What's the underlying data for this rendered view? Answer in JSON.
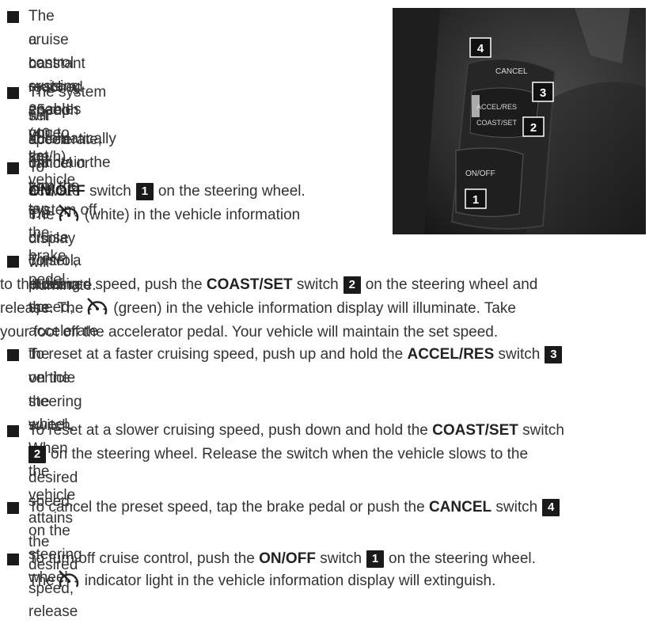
{
  "photo": {
    "cancel_label": "CANCEL",
    "accel_res_label": "ACCEL/RES",
    "coast_set_label": "COAST/SET",
    "on_off_label": "ON/OFF",
    "callouts": [
      "4",
      "3",
      "2",
      "1"
    ]
  },
  "items": [
    {
      "line1": "The cruise control system enables you to set",
      "line2": "a constant cruising speed once the vehicle",
      "line3": "has reached 25 mph (40 km/h)."
    },
    {
      "line1": "The system will automatically maintain the",
      "line2": "set speed until you tap the brake pedal,",
      "line3": "accelerate, cancel or turn the system off."
    },
    {
      "line1": "To activate the cruise control, push the",
      "l2_bold": "ON/OFF",
      "l2_a": " switch",
      "l2_badge": "1",
      "l2_b": "on the steering wheel.",
      "l3_a": "The",
      "l3_b": "(white) in the vehicle information",
      "line4": "display will illuminate."
    },
    {
      "line1": "To set a cruising speed, accelerate the vehicle",
      "l2_a": "to the desired speed, push the ",
      "l2_bold": "COAST/SET",
      "l2_b": " switch",
      "l2_badge": "2",
      "l2_c": "on the steering wheel and",
      "l3_a": "release. The",
      "l3_b": "(green) in the vehicle information display will illuminate. Take",
      "line4": "your foot off the accelerator pedal. Your vehicle will maintain the set speed."
    },
    {
      "l1_a": "To reset at a faster cruising speed, push up and hold the ",
      "l1_bold": "ACCEL/RES",
      "l1_b": " switch",
      "l1_badge": "3",
      "line2": "on the steering wheel. When the vehicle attains the desired speed, release",
      "line3": "the switch."
    },
    {
      "l1_a": "To reset at a slower cruising speed, push down and hold the ",
      "l1_bold": "COAST/SET",
      "l1_b": " switch",
      "l2_badge": "2",
      "l2_a": "on the steering wheel. Release the switch when the vehicle slows to the",
      "line3": "desired speed."
    },
    {
      "l1_a": "To cancel the preset speed, tap the brake pedal or push the ",
      "l1_bold": "CANCEL",
      "l1_b": " switch",
      "l1_badge": "4",
      "line2": "on the steering wheel."
    },
    {
      "l1_a": "To turn off cruise control, push the ",
      "l1_bold": "ON/OFF",
      "l1_b": " switch",
      "l1_badge": "1",
      "l1_c": "on the steering wheel.",
      "l2_a": "The",
      "l2_b": "indicator light in the vehicle information display will extinguish."
    }
  ]
}
